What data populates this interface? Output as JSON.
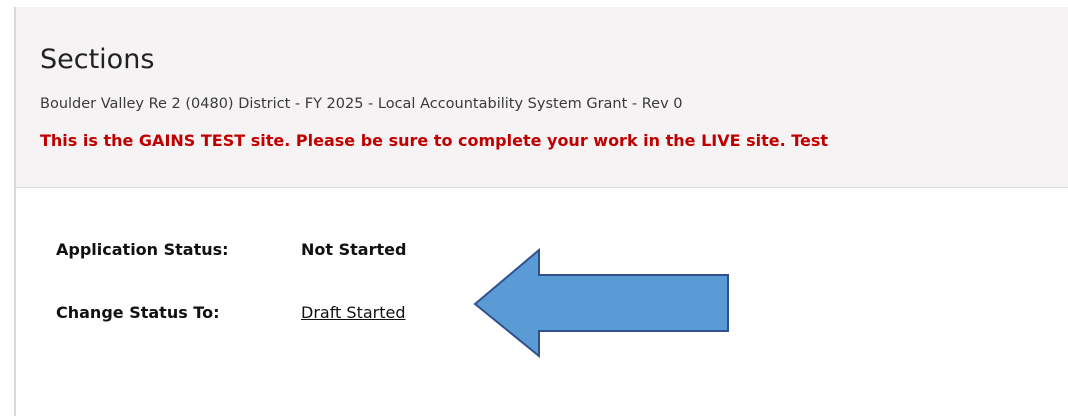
{
  "header": {
    "title": "Sections",
    "subtitle": "Boulder Valley Re 2 (0480) District - FY 2025 - Local Accountability System Grant - Rev 0",
    "warning": "This is the GAINS TEST site. Please be sure to complete your work in the LIVE site. Test"
  },
  "status": {
    "application_status_label": "Application Status:",
    "application_status_value": "Not Started",
    "change_status_label": "Change Status To:",
    "change_status_link": "Draft Started"
  },
  "annotation": {
    "arrow_color": "#5b9bd5",
    "arrow_outline": "#2f528f",
    "arrow_direction": "left"
  },
  "colors": {
    "header_bg": "#f6f3f4",
    "warning_text": "#c00000"
  }
}
